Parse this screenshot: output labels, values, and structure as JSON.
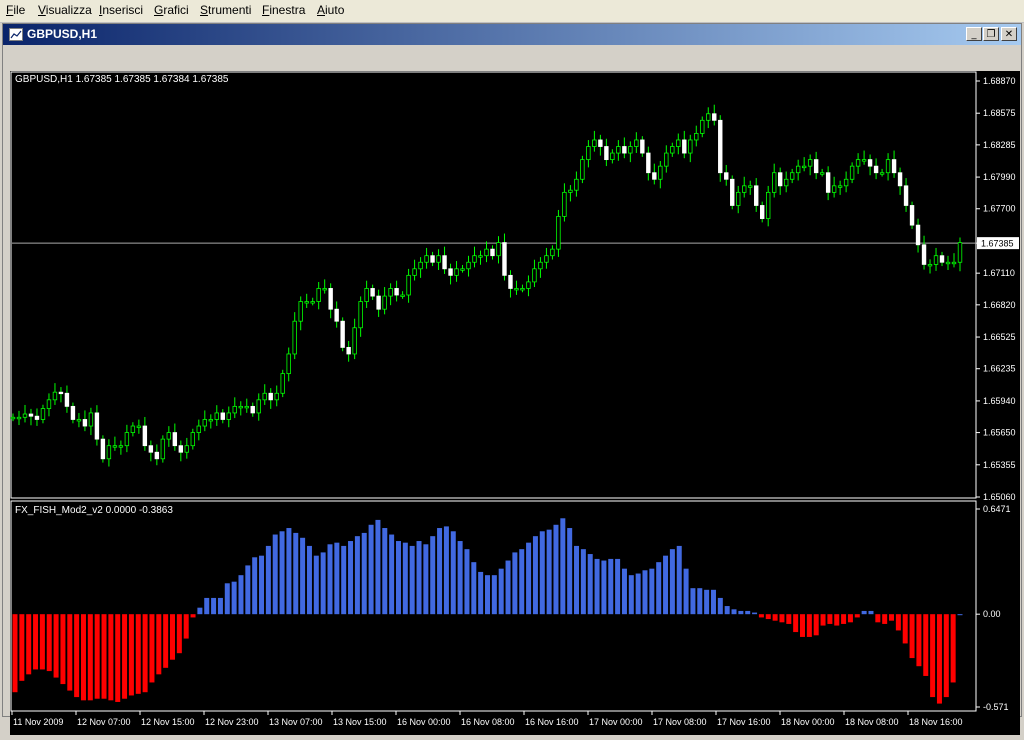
{
  "menu": {
    "items": [
      {
        "label": "File"
      },
      {
        "label": "Visualizza"
      },
      {
        "label": "Inserisci"
      },
      {
        "label": "Grafici"
      },
      {
        "label": "Strumenti"
      },
      {
        "label": "Finestra"
      },
      {
        "label": "Aiuto"
      }
    ]
  },
  "window": {
    "title": "GBPUSD,H1",
    "minimize": "_",
    "restore": "❐",
    "close": "✕"
  },
  "colors": {
    "background": "#000000",
    "axis": "#ffffff",
    "candle_up": "#ffffff",
    "candle_wick": "#00ff00",
    "hist_positive": "#4169e1",
    "hist_negative": "#ff0000",
    "price_line": "#aaaaaa"
  },
  "chart_data": [
    {
      "type": "candlestick",
      "header": "GBPUSD,H1  1.67385 1.67385 1.67384 1.67385",
      "yticks": [
        "1.68870",
        "1.68575",
        "1.68285",
        "1.67990",
        "1.67700",
        "1.67385",
        "1.67110",
        "1.66820",
        "1.66525",
        "1.66235",
        "1.65940",
        "1.65650",
        "1.65355",
        "1.65060"
      ],
      "ylim": [
        1.6506,
        1.6887
      ],
      "current_price": 1.67385,
      "current_price_label": "1.67385",
      "close": [
        1.6579,
        1.6579,
        1.6582,
        1.658,
        1.6577,
        1.6587,
        1.6595,
        1.6602,
        1.6601,
        1.6589,
        1.6577,
        1.6577,
        1.6571,
        1.6583,
        1.6559,
        1.6541,
        1.6553,
        1.6553,
        1.6553,
        1.6565,
        1.6571,
        1.6571,
        1.6553,
        1.6547,
        1.6541,
        1.6559,
        1.6565,
        1.6553,
        1.6547,
        1.6553,
        1.6565,
        1.6571,
        1.6577,
        1.6577,
        1.6583,
        1.6577,
        1.6583,
        1.6589,
        1.6589,
        1.6589,
        1.6583,
        1.6595,
        1.6601,
        1.6595,
        1.6601,
        1.6619,
        1.6637,
        1.6667,
        1.6685,
        1.6685,
        1.6685,
        1.6697,
        1.6697,
        1.6678,
        1.6667,
        1.6643,
        1.6637,
        1.6661,
        1.6685,
        1.6697,
        1.669,
        1.6678,
        1.669,
        1.6697,
        1.6691,
        1.6691,
        1.6709,
        1.6715,
        1.6721,
        1.6727,
        1.6721,
        1.6727,
        1.6715,
        1.6709,
        1.6715,
        1.6715,
        1.6721,
        1.6727,
        1.6727,
        1.6733,
        1.6727,
        1.6739,
        1.6709,
        1.6697,
        1.6697,
        1.6697,
        1.6703,
        1.6715,
        1.6721,
        1.6727,
        1.6733,
        1.6763,
        1.6785,
        1.6787,
        1.6797,
        1.6815,
        1.6827,
        1.6833,
        1.6827,
        1.6815,
        1.6821,
        1.6827,
        1.6821,
        1.6827,
        1.6833,
        1.6821,
        1.6803,
        1.6797,
        1.6809,
        1.6821,
        1.6827,
        1.6833,
        1.6821,
        1.6833,
        1.6839,
        1.6851,
        1.6857,
        1.6851,
        1.6803,
        1.6797,
        1.6773,
        1.6785,
        1.6791,
        1.6791,
        1.6773,
        1.6761,
        1.6785,
        1.6803,
        1.6791,
        1.6797,
        1.6803,
        1.6809,
        1.6809,
        1.6815,
        1.6803,
        1.6803,
        1.6785,
        1.6791,
        1.6791,
        1.6797,
        1.6809,
        1.6815,
        1.6815,
        1.6809,
        1.6803,
        1.6803,
        1.6815,
        1.6803,
        1.6791,
        1.6773,
        1.6755,
        1.6737,
        1.6719,
        1.6719,
        1.6727,
        1.6721,
        1.6721,
        1.6721,
        1.6739
      ]
    },
    {
      "type": "bar",
      "header": "FX_FISH_Mod2_v2 0.0000 -0.3863",
      "yticks": [
        "0.6471",
        "0.00",
        "-0.571"
      ],
      "ylim": [
        -0.571,
        0.6471
      ],
      "values": [
        -0.48,
        -0.41,
        -0.37,
        -0.34,
        -0.34,
        -0.35,
        -0.39,
        -0.43,
        -0.47,
        -0.51,
        -0.53,
        -0.53,
        -0.52,
        -0.52,
        -0.53,
        -0.54,
        -0.52,
        -0.5,
        -0.49,
        -0.48,
        -0.42,
        -0.37,
        -0.33,
        -0.28,
        -0.24,
        -0.15,
        -0.02,
        0.04,
        0.1,
        0.1,
        0.1,
        0.19,
        0.2,
        0.24,
        0.3,
        0.35,
        0.36,
        0.42,
        0.49,
        0.51,
        0.53,
        0.5,
        0.47,
        0.42,
        0.36,
        0.38,
        0.43,
        0.44,
        0.42,
        0.45,
        0.48,
        0.5,
        0.55,
        0.58,
        0.53,
        0.49,
        0.45,
        0.44,
        0.42,
        0.45,
        0.43,
        0.48,
        0.53,
        0.54,
        0.51,
        0.45,
        0.4,
        0.32,
        0.26,
        0.24,
        0.24,
        0.28,
        0.33,
        0.38,
        0.4,
        0.44,
        0.48,
        0.51,
        0.52,
        0.55,
        0.59,
        0.53,
        0.42,
        0.4,
        0.37,
        0.34,
        0.33,
        0.34,
        0.34,
        0.28,
        0.24,
        0.25,
        0.27,
        0.28,
        0.32,
        0.36,
        0.4,
        0.42,
        0.28,
        0.16,
        0.16,
        0.15,
        0.15,
        0.1,
        0.05,
        0.03,
        0.02,
        0.02,
        0.01,
        -0.02,
        -0.03,
        -0.04,
        -0.05,
        -0.06,
        -0.11,
        -0.14,
        -0.14,
        -0.13,
        -0.07,
        -0.06,
        -0.07,
        -0.06,
        -0.05,
        -0.02,
        0.02,
        0.02,
        -0.05,
        -0.06,
        -0.04,
        -0.1,
        -0.18,
        -0.27,
        -0.32,
        -0.38,
        -0.51,
        -0.55,
        -0.51,
        -0.42,
        -0.0
      ]
    }
  ],
  "time_axis": {
    "labels": [
      "11 Nov 2009",
      "12 Nov 07:00",
      "12 Nov 15:00",
      "12 Nov 23:00",
      "13 Nov 07:00",
      "13 Nov 15:00",
      "16 Nov 00:00",
      "16 Nov 08:00",
      "16 Nov 16:00",
      "17 Nov 00:00",
      "17 Nov 08:00",
      "17 Nov 16:00",
      "18 Nov 00:00",
      "18 Nov 08:00",
      "18 Nov 16:00"
    ]
  }
}
